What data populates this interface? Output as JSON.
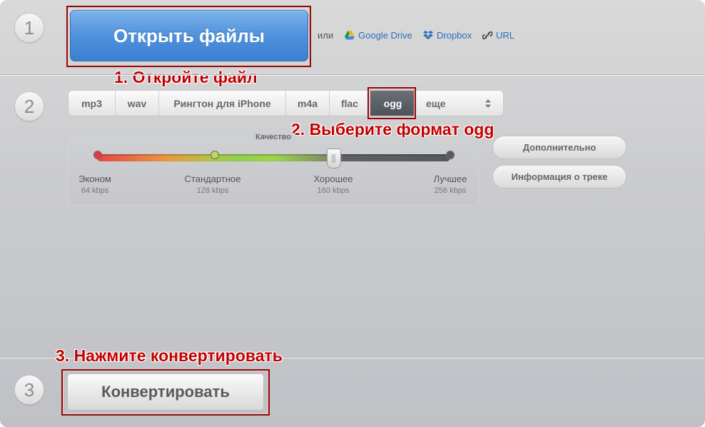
{
  "steps": {
    "one": "1",
    "two": "2",
    "three": "3"
  },
  "upload": {
    "open_button": "Открыть файлы",
    "or_label": "или",
    "sources": [
      {
        "label": "Google Drive",
        "icon": "google-drive-icon"
      },
      {
        "label": "Dropbox",
        "icon": "dropbox-icon"
      },
      {
        "label": "URL",
        "icon": "link-icon"
      }
    ]
  },
  "formats": {
    "tabs": [
      "mp3",
      "wav",
      "Рингтон для iPhone",
      "m4a",
      "flac",
      "ogg"
    ],
    "selected": "ogg",
    "more_label": "еще"
  },
  "quality": {
    "title": "Качество",
    "levels": [
      {
        "name": "Эконом",
        "rate": "64 kbps"
      },
      {
        "name": "Стандартное",
        "rate": "128 kbps"
      },
      {
        "name": "Хорошее",
        "rate": "160 kbps"
      },
      {
        "name": "Лучшее",
        "rate": "256 kbps"
      }
    ],
    "selected": "Хорошее"
  },
  "side_buttons": {
    "advanced": "Дополнительно",
    "track_info": "Информация о треке"
  },
  "convert": {
    "button": "Конвертировать"
  },
  "annotations": {
    "step1": "1. Откройте файл",
    "step2": "2. Выберите формат ogg",
    "step3": "3. Нажмите конвертировать"
  },
  "colors": {
    "primary_button": "#4f91dc",
    "annotation": "#c10000",
    "annotation_box": "#8e0b0b",
    "selected_tab": "#555a61"
  }
}
